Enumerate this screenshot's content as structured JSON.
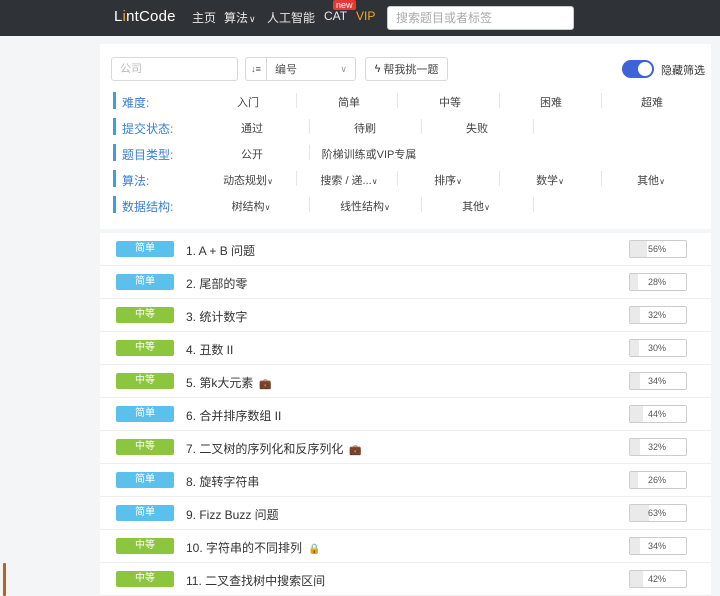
{
  "nav": {
    "logo_pre": "L",
    "logo_bolt": "i",
    "logo_post": "ntCode",
    "items": [
      "主页",
      "算法",
      "人工智能",
      "CAT",
      "VIP"
    ],
    "new_badge": "new",
    "search_placeholder": "搜索题目或者标签"
  },
  "filters": {
    "company_placeholder": "公司",
    "sort_icon": "↓≡",
    "sort_value": "编号",
    "pick_button": "帮我挑一题",
    "hide_toggle_label": "隐藏筛选",
    "rows": [
      {
        "label": "难度:",
        "options": [
          "入门",
          "简单",
          "中等",
          "困难",
          "超难"
        ]
      },
      {
        "label": "提交状态:",
        "options": [
          "通过",
          "待刷",
          "失败"
        ]
      },
      {
        "label": "题目类型:",
        "options": [
          "公开",
          "阶梯训练或VIP专属"
        ]
      },
      {
        "label": "算法:",
        "options": [
          "动态规划",
          "搜索 / 递...",
          "排序",
          "数学",
          "其他"
        ]
      },
      {
        "label": "数据结构:",
        "options": [
          "树结构",
          "线性结构",
          "其他"
        ]
      }
    ]
  },
  "problems": [
    {
      "difficulty": "简单",
      "level": "easy",
      "title": "1. A + B 问题",
      "icon": "",
      "rate": "56%",
      "rate_value": 56
    },
    {
      "difficulty": "简单",
      "level": "easy",
      "title": "2. 尾部的零",
      "icon": "",
      "rate": "28%",
      "rate_value": 28
    },
    {
      "difficulty": "中等",
      "level": "medium",
      "title": "3. 统计数字",
      "icon": "",
      "rate": "32%",
      "rate_value": 32
    },
    {
      "difficulty": "中等",
      "level": "medium",
      "title": "4. 丑数 II",
      "icon": "",
      "rate": "30%",
      "rate_value": 30
    },
    {
      "difficulty": "中等",
      "level": "medium",
      "title": "5. 第k大元素",
      "icon": "briefcase-icon",
      "rate": "34%",
      "rate_value": 34
    },
    {
      "difficulty": "简单",
      "level": "easy",
      "title": "6. 合并排序数组 II",
      "icon": "",
      "rate": "44%",
      "rate_value": 44
    },
    {
      "difficulty": "中等",
      "level": "medium",
      "title": "7. 二叉树的序列化和反序列化",
      "icon": "briefcase-icon",
      "rate": "32%",
      "rate_value": 32
    },
    {
      "difficulty": "简单",
      "level": "easy",
      "title": "8. 旋转字符串",
      "icon": "",
      "rate": "26%",
      "rate_value": 26
    },
    {
      "difficulty": "简单",
      "level": "easy",
      "title": "9. Fizz Buzz 问题",
      "icon": "",
      "rate": "63%",
      "rate_value": 63
    },
    {
      "difficulty": "中等",
      "level": "medium",
      "title": "10. 字符串的不同排列",
      "icon": "lock-icon",
      "rate": "34%",
      "rate_value": 34
    },
    {
      "difficulty": "中等",
      "level": "medium",
      "title": "11. 二叉查找树中搜索区间",
      "icon": "",
      "rate": "42%",
      "rate_value": 42
    }
  ]
}
